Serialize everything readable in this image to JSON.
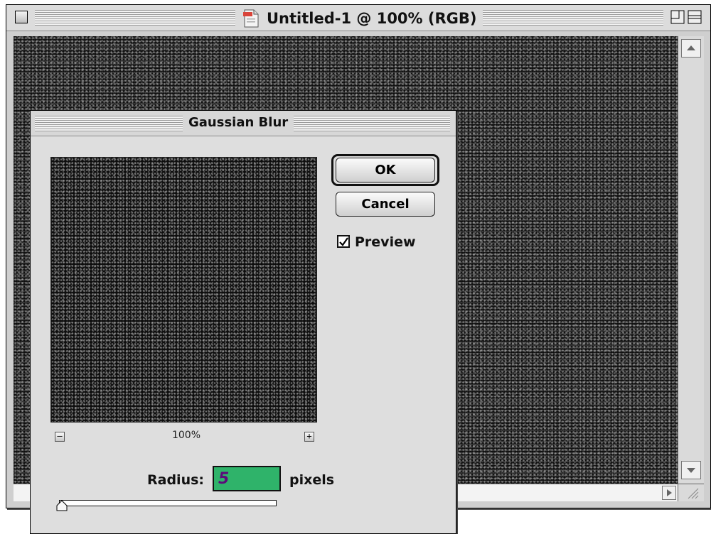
{
  "document_window": {
    "title": "Untitled-1 @ 100% (RGB)"
  },
  "dialog": {
    "title": "Gaussian Blur",
    "preview_zoom": "100%",
    "zoom_out_label": "–",
    "zoom_in_label": "+",
    "ok_label": "OK",
    "cancel_label": "Cancel",
    "preview_label": "Preview",
    "preview_checked": true,
    "radius_label": "Radius:",
    "radius_value": "5",
    "units_label": "pixels",
    "radius_field_color": "#2fb36a"
  }
}
